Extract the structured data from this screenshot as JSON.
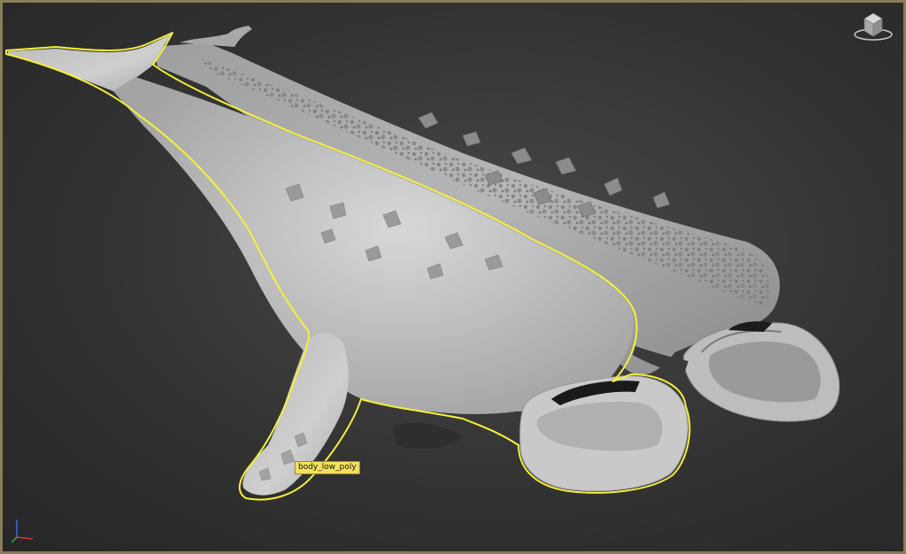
{
  "viewport": {
    "background_color": "#333333",
    "border_color": "#8a7d5a",
    "selection_color": "#f5f03a"
  },
  "tooltip": {
    "object_name": "body_low_poly"
  },
  "icons": {
    "viewcube": "viewcube-icon",
    "axis": "axis-tripod-icon"
  }
}
